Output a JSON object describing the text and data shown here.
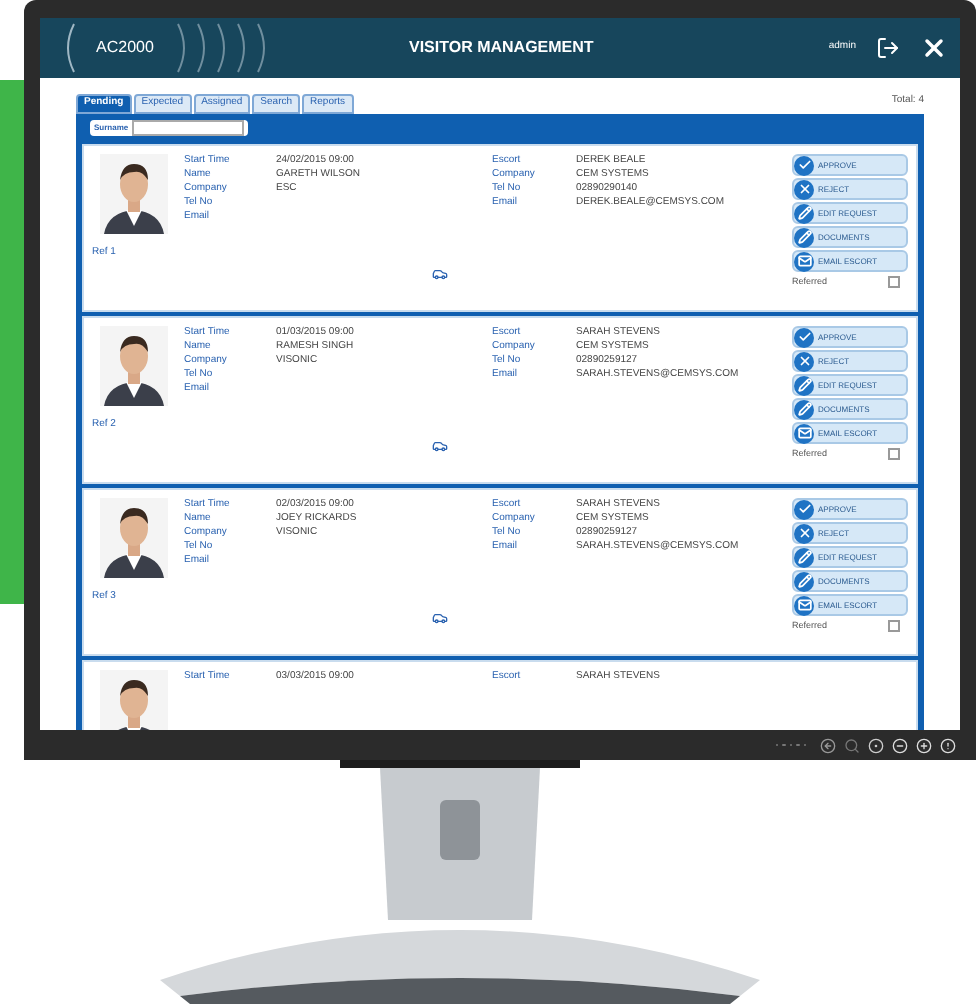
{
  "header": {
    "logo": "AC2000",
    "title": "VISITOR MANAGEMENT",
    "user": "admin"
  },
  "tabs": [
    {
      "label": "Pending",
      "selected": true
    },
    {
      "label": "Expected",
      "selected": false
    },
    {
      "label": "Assigned",
      "selected": false
    },
    {
      "label": "Search",
      "selected": false
    },
    {
      "label": "Reports",
      "selected": false
    }
  ],
  "total": "Total: 4",
  "search": {
    "label": "Surname"
  },
  "visitors": [
    {
      "kind": "full",
      "ref": "Ref 1",
      "fields": [
        {
          "label": "Start Time",
          "value": "24/02/2015 09:00"
        },
        {
          "label": "Name",
          "value": "GARETH WILSON"
        },
        {
          "label": "Company",
          "value": "ESC"
        },
        {
          "label": "Tel No"
        },
        {
          "label": "Email"
        }
      ],
      "escort": [
        {
          "label": "Escort",
          "value": "DEREK BEALE"
        },
        {
          "label": "Company",
          "value": "CEM SYSTEMS"
        },
        {
          "label": "Tel No",
          "value": "02890290140"
        },
        {
          "label": "Email",
          "value": "DEREK.BEALE@CEMSYS.COM"
        }
      ],
      "actions": [
        {
          "kind": "approve",
          "label": "APPROVE"
        },
        {
          "kind": "reject",
          "label": "REJECT"
        },
        {
          "kind": "edit",
          "label": "EDIT REQUEST"
        },
        {
          "kind": "documents",
          "label": "DOCUMENTS"
        },
        {
          "kind": "email",
          "label": "EMAIL ESCORT"
        }
      ],
      "referred_label": "Referred",
      "referred": false
    },
    {
      "kind": "full",
      "ref": "Ref 2",
      "fields": [
        {
          "label": "Start Time",
          "value": "01/03/2015 09:00"
        },
        {
          "label": "Name",
          "value": "RAMESH SINGH"
        },
        {
          "label": "Company",
          "value": "VISONIC"
        },
        {
          "label": "Tel No"
        },
        {
          "label": "Email"
        }
      ],
      "escort": [
        {
          "label": "Escort",
          "value": "SARAH STEVENS"
        },
        {
          "label": "Company",
          "value": "CEM SYSTEMS"
        },
        {
          "label": "Tel No",
          "value": "02890259127"
        },
        {
          "label": "Email",
          "value": "SARAH.STEVENS@CEMSYS.COM"
        }
      ],
      "actions": [
        {
          "kind": "approve",
          "label": "APPROVE"
        },
        {
          "kind": "reject",
          "label": "REJECT"
        },
        {
          "kind": "edit",
          "label": "EDIT REQUEST"
        },
        {
          "kind": "documents",
          "label": "DOCUMENTS"
        },
        {
          "kind": "email",
          "label": "EMAIL ESCORT"
        }
      ],
      "referred_label": "Referred",
      "referred": false
    },
    {
      "kind": "full",
      "ref": "Ref 3",
      "fields": [
        {
          "label": "Start Time",
          "value": "02/03/2015 09:00"
        },
        {
          "label": "Name",
          "value": "JOEY RICKARDS"
        },
        {
          "label": "Company",
          "value": "VISONIC"
        },
        {
          "label": "Tel No"
        },
        {
          "label": "Email"
        }
      ],
      "escort": [
        {
          "label": "Escort",
          "value": "SARAH STEVENS"
        },
        {
          "label": "Company",
          "value": "CEM SYSTEMS"
        },
        {
          "label": "Tel No",
          "value": "02890259127"
        },
        {
          "label": "Email",
          "value": "SARAH.STEVENS@CEMSYS.COM"
        }
      ],
      "actions": [
        {
          "kind": "approve",
          "label": "APPROVE"
        },
        {
          "kind": "reject",
          "label": "REJECT"
        },
        {
          "kind": "edit",
          "label": "EDIT REQUEST"
        },
        {
          "kind": "documents",
          "label": "DOCUMENTS"
        },
        {
          "kind": "email",
          "label": "EMAIL ESCORT"
        }
      ],
      "referred_label": "Referred",
      "referred": false
    },
    {
      "kind": "partial",
      "fields": [
        {
          "label": "Start Time",
          "value": "03/03/2015 09:00"
        }
      ],
      "escort": [
        {
          "label": "Escort",
          "value": "SARAH STEVENS"
        }
      ]
    }
  ]
}
